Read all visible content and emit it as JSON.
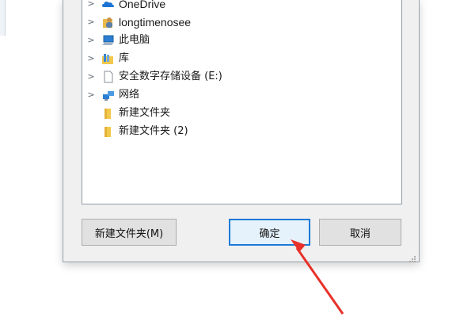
{
  "tree": {
    "items": [
      {
        "label": "OneDrive",
        "icon": "onedrive-cloud-icon",
        "expandable": true
      },
      {
        "label": "longtimenosee",
        "icon": "user-folder-icon",
        "expandable": true
      },
      {
        "label": "此电脑",
        "icon": "this-pc-icon",
        "expandable": true
      },
      {
        "label": "库",
        "icon": "library-icon",
        "expandable": true
      },
      {
        "label": "安全数字存储设备 (E:)",
        "icon": "sd-card-drive-icon",
        "expandable": true
      },
      {
        "label": "网络",
        "icon": "network-icon",
        "expandable": true
      },
      {
        "label": "新建文件夹",
        "icon": "folder-icon",
        "expandable": false
      },
      {
        "label": "新建文件夹 (2)",
        "icon": "folder-icon",
        "expandable": false
      }
    ]
  },
  "buttons": {
    "new_folder": "新建文件夹(M)",
    "ok": "确定",
    "cancel": "取消"
  },
  "colors": {
    "accent": "#1a7bd6",
    "annotation_arrow": "#e8312a",
    "folder": "#f2c94c"
  }
}
